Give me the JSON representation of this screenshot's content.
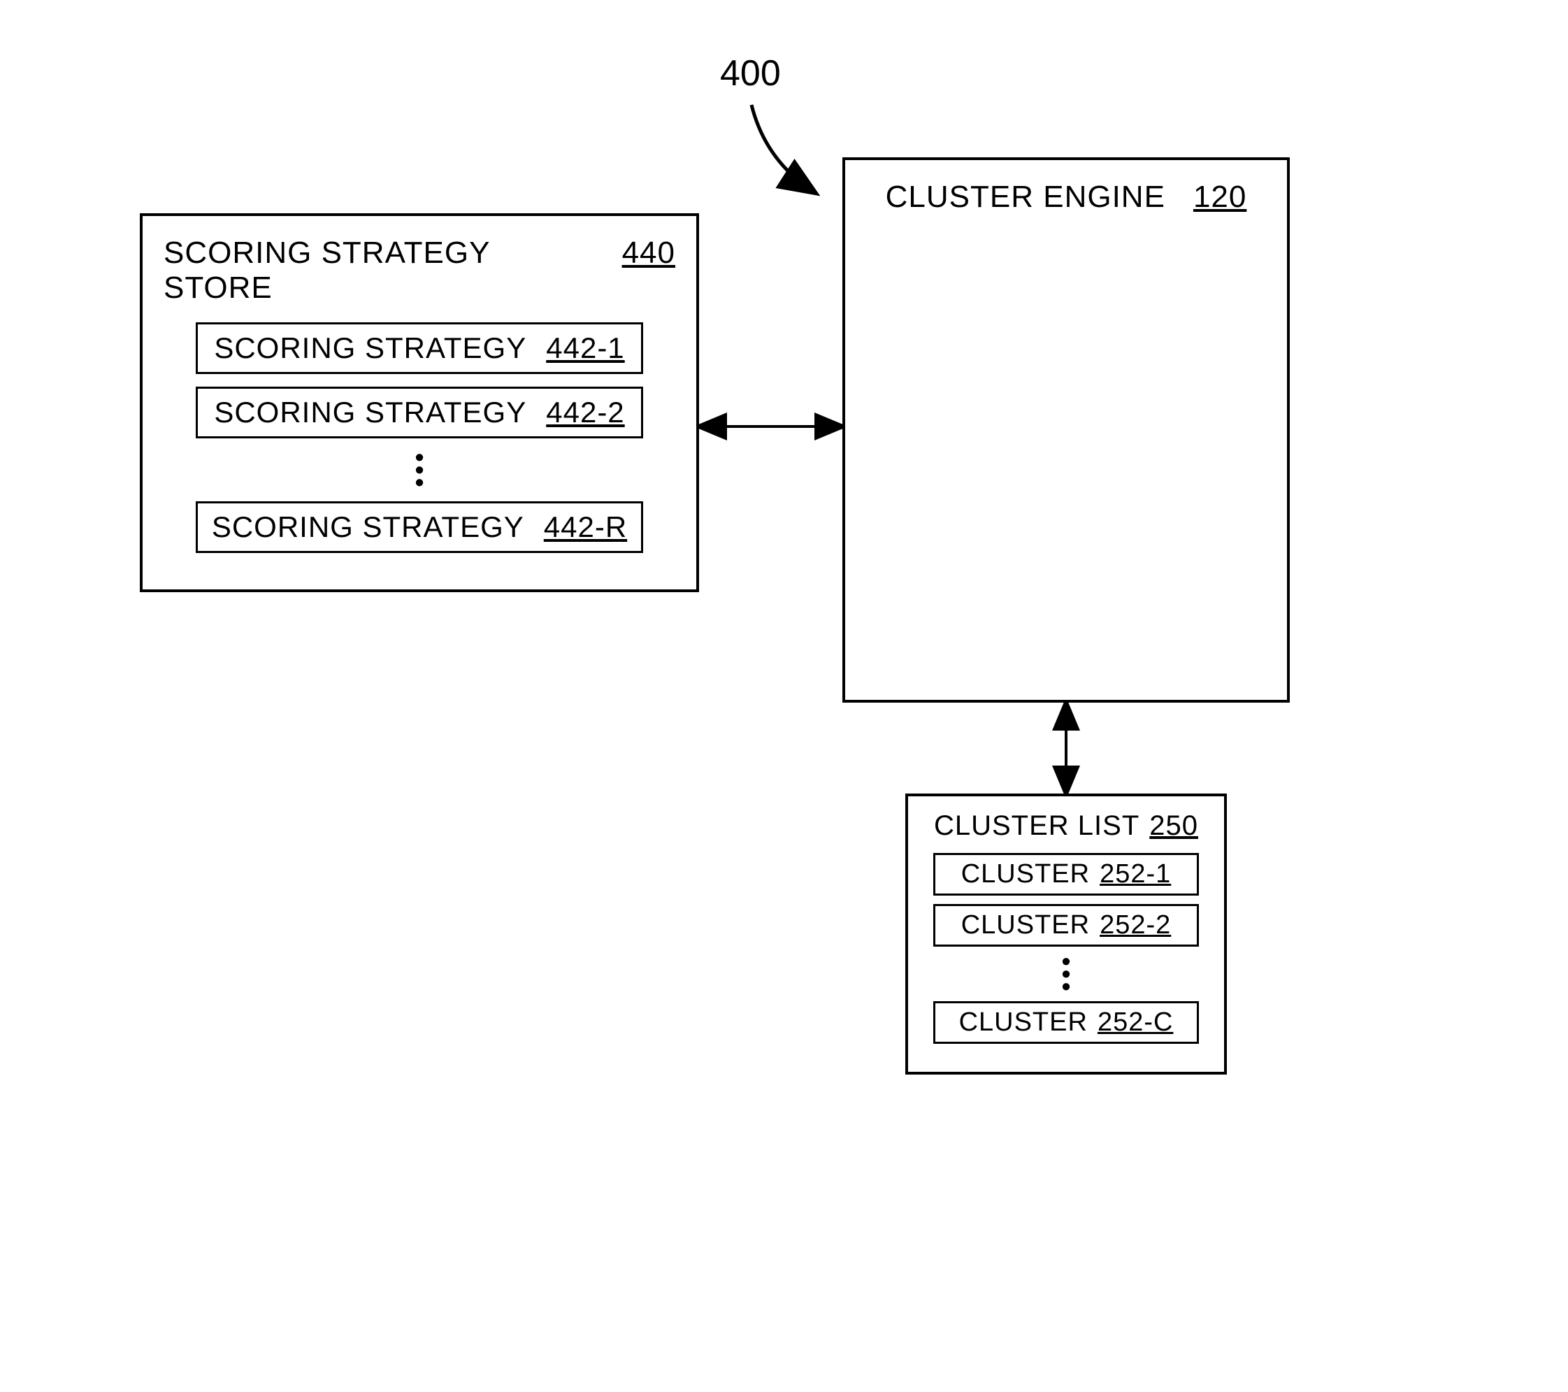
{
  "figure_ref": "400",
  "store": {
    "title": "SCORING STRATEGY STORE",
    "ref": "440",
    "items": [
      {
        "label": "SCORING STRATEGY",
        "ref": "442-1"
      },
      {
        "label": "SCORING STRATEGY",
        "ref": "442-2"
      },
      {
        "label": "SCORING STRATEGY",
        "ref": "442-R"
      }
    ]
  },
  "engine": {
    "title": "CLUSTER  ENGINE",
    "ref": "120"
  },
  "cluster_list": {
    "title": "CLUSTER LIST",
    "ref": "250",
    "items": [
      {
        "label": "CLUSTER",
        "ref": "252-1"
      },
      {
        "label": "CLUSTER",
        "ref": "252-2"
      },
      {
        "label": "CLUSTER",
        "ref": "252-C"
      }
    ]
  }
}
